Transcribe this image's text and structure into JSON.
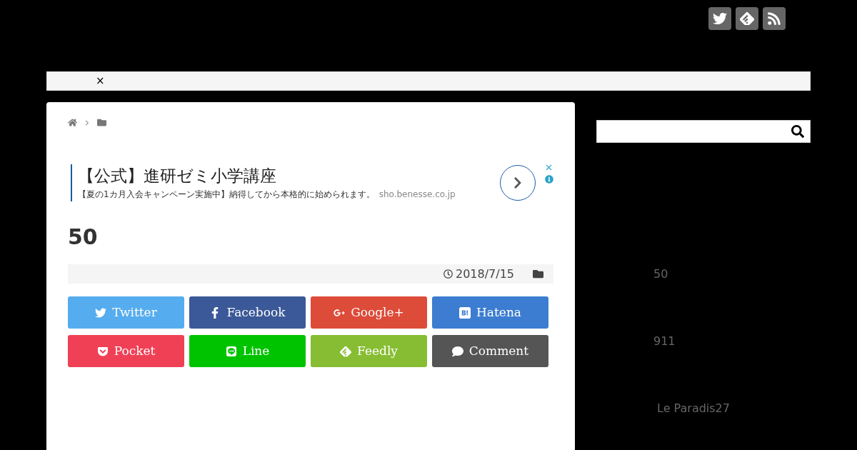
{
  "header": {
    "social_icons": [
      {
        "kind": "twitter"
      },
      {
        "kind": "feedly"
      },
      {
        "kind": "rss"
      }
    ]
  },
  "notice_bar": {
    "close": "×"
  },
  "ad": {
    "title": "【公式】進研ゼミ小学講座",
    "description": "【夏の1カ月入会キャンペーン実施中】納得してから本格的に始められます。",
    "domain": "sho.benesse.co.jp"
  },
  "article": {
    "title": "50",
    "date": "2018/7/15"
  },
  "share_buttons": [
    {
      "kind": "twitter",
      "label": "Twitter",
      "color": "#55acee"
    },
    {
      "kind": "facebook",
      "label": "Facebook",
      "color": "#3b5998"
    },
    {
      "kind": "googleplus",
      "label": "Google+",
      "color": "#dd4b39"
    },
    {
      "kind": "hatena",
      "label": "Hatena",
      "color": "#3c7dd1"
    },
    {
      "kind": "pocket",
      "label": "Pocket",
      "color": "#ef4056"
    },
    {
      "kind": "line",
      "label": "Line",
      "color": "#00c300"
    },
    {
      "kind": "feedly",
      "label": "Feedly",
      "color": "#87bd33"
    },
    {
      "kind": "comment",
      "label": "Comment",
      "color": "#555555"
    }
  ],
  "sidebar": {
    "items": [
      {
        "label": "50"
      },
      {
        "label": "911"
      },
      {
        "label": "Le Paradis27"
      }
    ]
  }
}
